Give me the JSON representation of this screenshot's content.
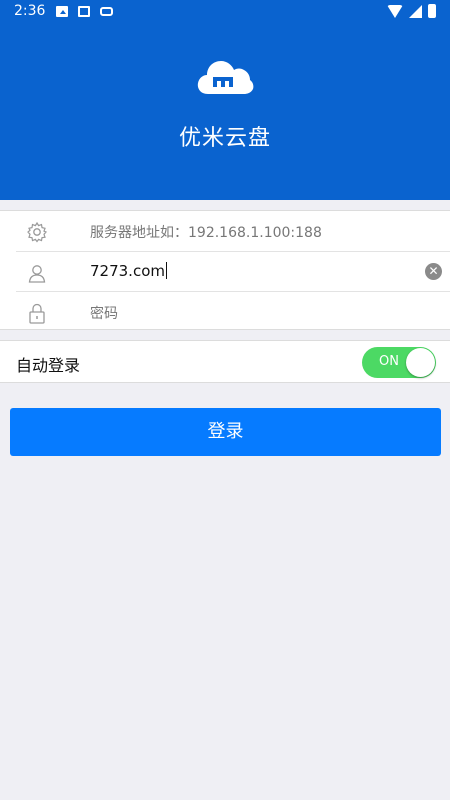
{
  "status_bar": {
    "time": "2:36"
  },
  "app": {
    "title": "优米云盘"
  },
  "form": {
    "server": {
      "placeholder": "服务器地址如：192.168.1.100:188",
      "value": ""
    },
    "username": {
      "value": "7273.com"
    },
    "password": {
      "placeholder": "密码",
      "value": ""
    }
  },
  "auto_login": {
    "label": "自动登录",
    "toggle_text": "ON",
    "enabled": true
  },
  "login_button": {
    "label": "登录"
  },
  "colors": {
    "header": "#0a63cf",
    "primary_button": "#067bff",
    "toggle_on": "#4cd964",
    "background": "#efeff4"
  },
  "icons": [
    "gear-icon",
    "user-icon",
    "lock-icon",
    "clear-icon",
    "cloud-logo-icon"
  ]
}
